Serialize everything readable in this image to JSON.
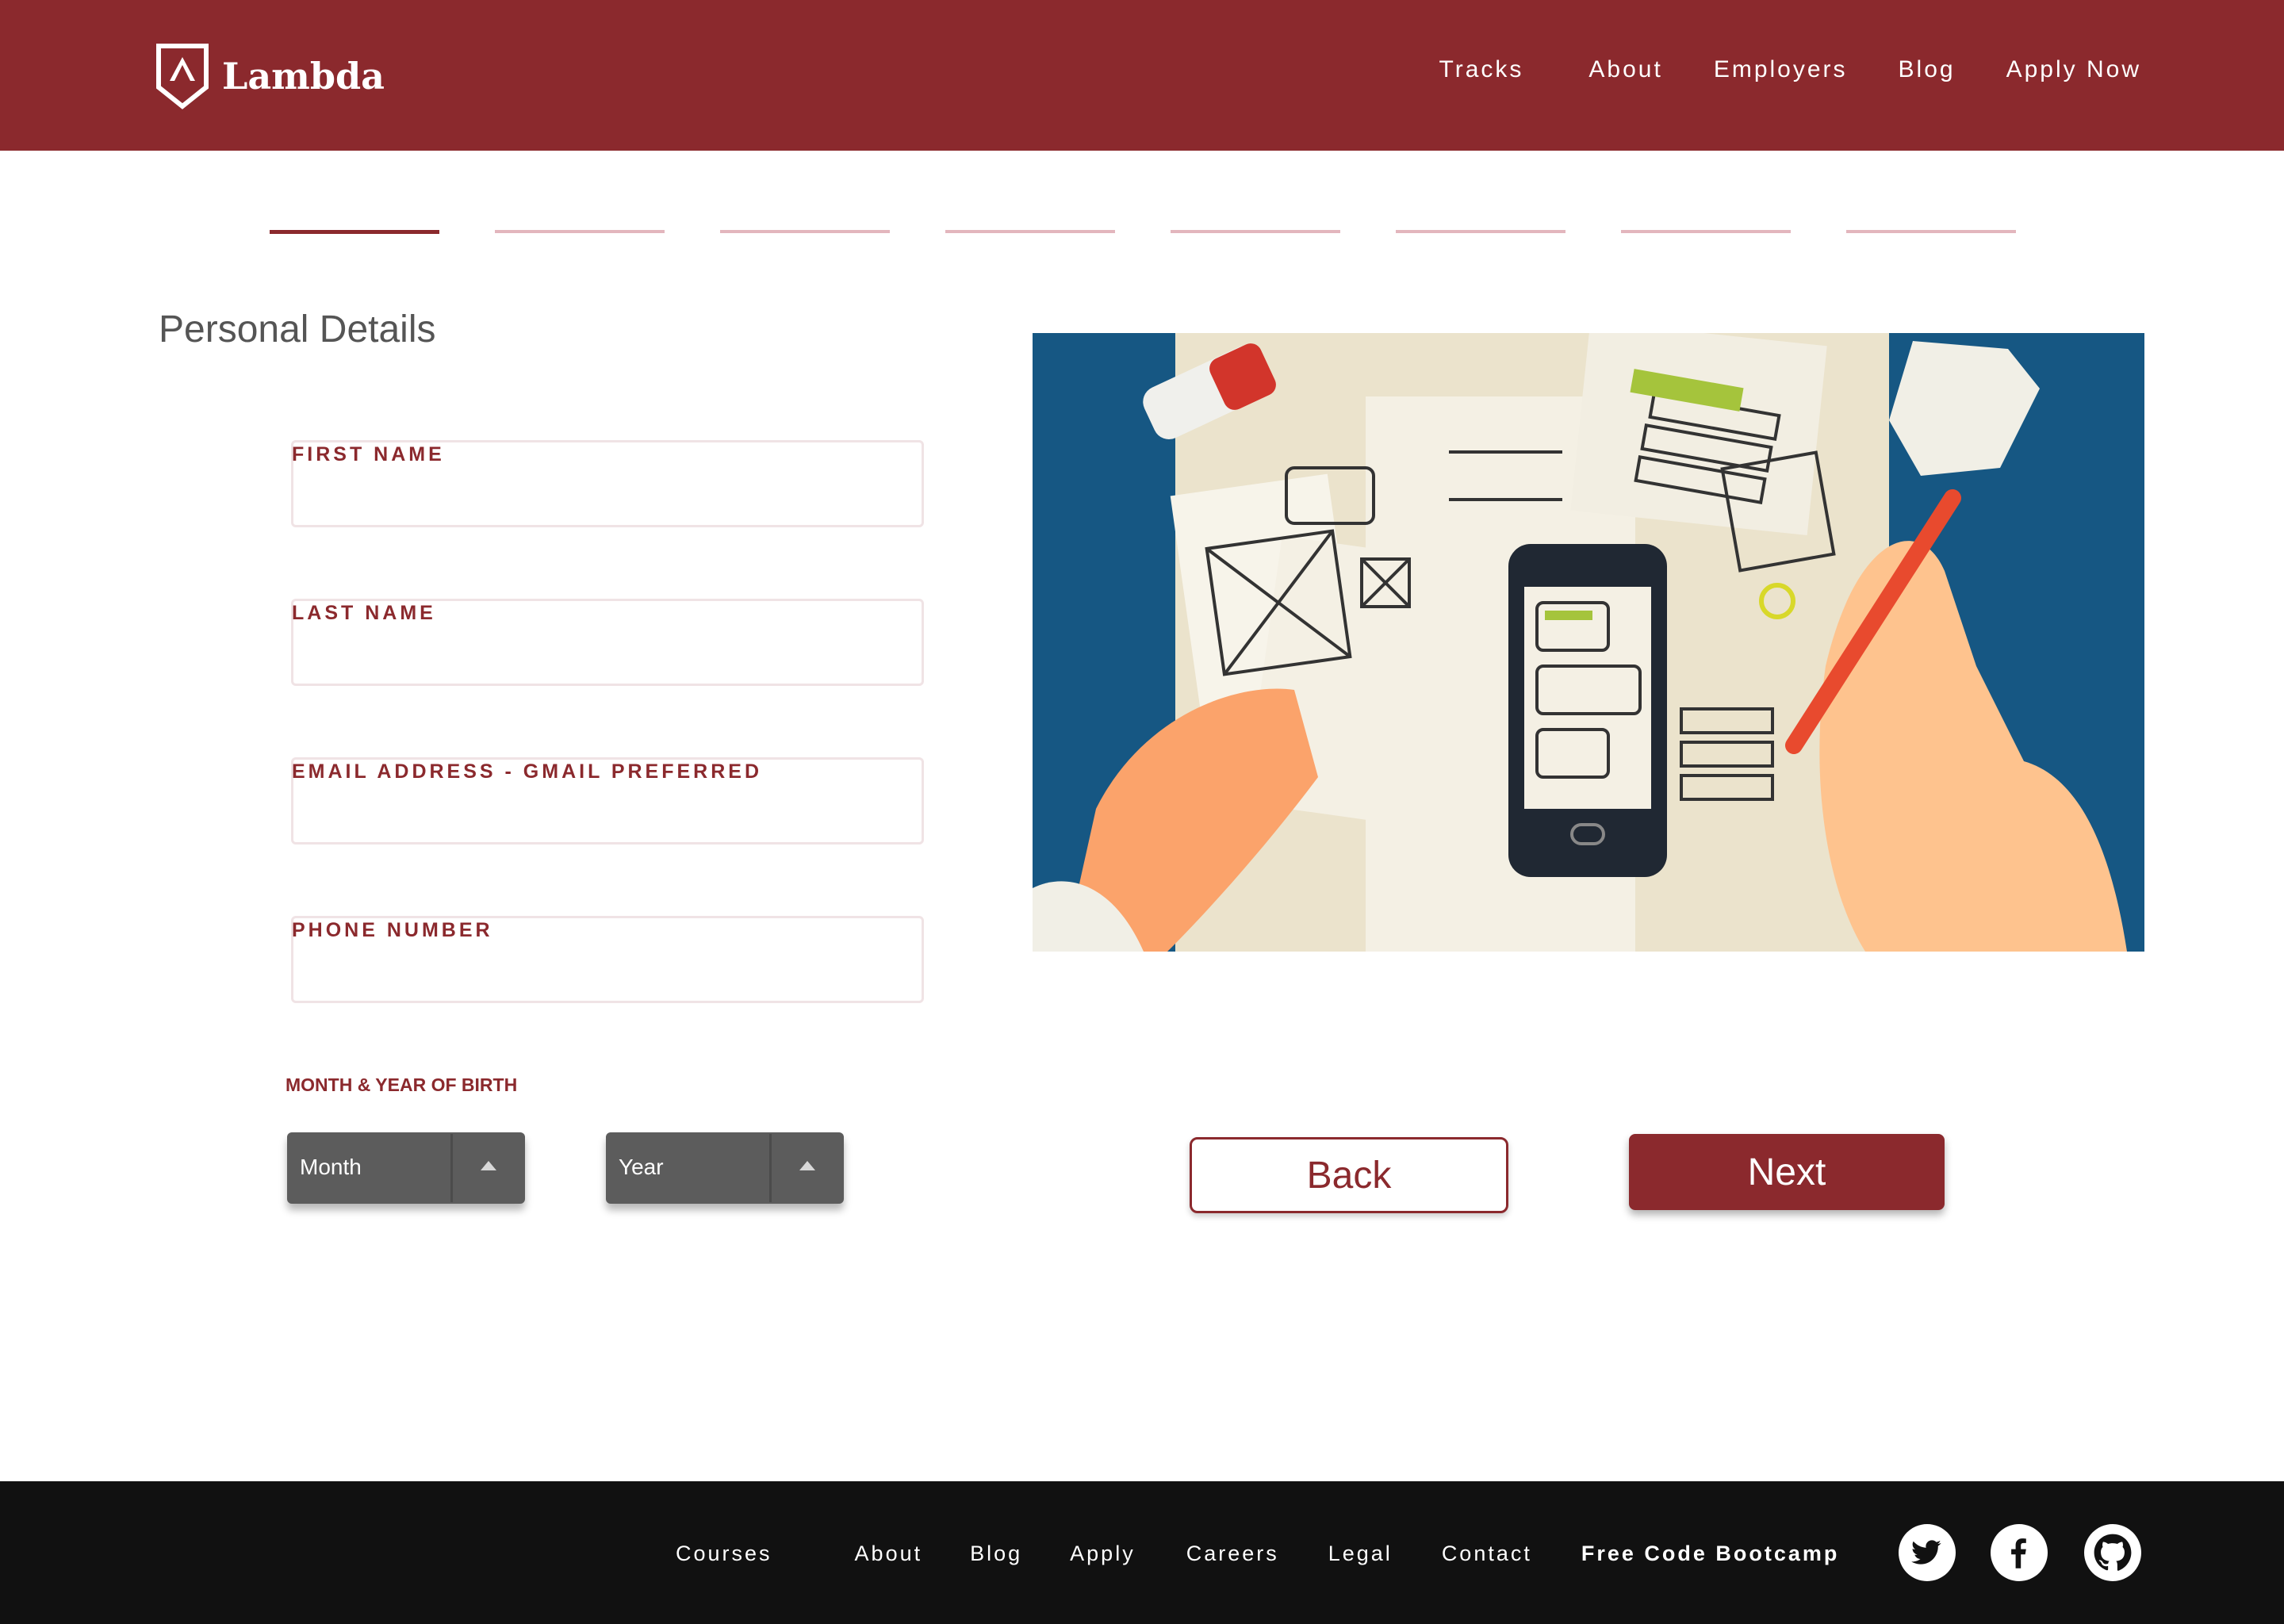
{
  "header": {
    "logo_text": "Lambda",
    "nav": [
      "Tracks",
      "About",
      "Employers",
      "Blog",
      "Apply Now"
    ]
  },
  "progress": {
    "total_steps": 8,
    "current_step": 1
  },
  "form": {
    "title": "Personal Details",
    "fields": [
      {
        "label": "FIRST NAME",
        "value": ""
      },
      {
        "label": "LAST NAME",
        "value": ""
      },
      {
        "label": "EMAIL ADDRESS - GMAIL PREFERRED",
        "value": ""
      },
      {
        "label": "PHONE NUMBER",
        "value": ""
      }
    ],
    "dob_label": "MONTH & YEAR OF BIRTH",
    "month_select": "Month",
    "year_select": "Year"
  },
  "buttons": {
    "back": "Back",
    "next": "Next"
  },
  "footer": {
    "links": [
      "Courses",
      "About",
      "Blog",
      "Apply",
      "Careers",
      "Legal",
      "Contact",
      "Free Code Bootcamp"
    ],
    "social_icons": [
      "twitter-icon",
      "facebook-icon",
      "github-icon"
    ]
  },
  "colors": {
    "brand": "#8b292d",
    "progress_inactive": "#e3b6bd",
    "footer_bg": "#111111",
    "select_bg": "#5c5c5c",
    "illustration_bg": "#165783"
  }
}
